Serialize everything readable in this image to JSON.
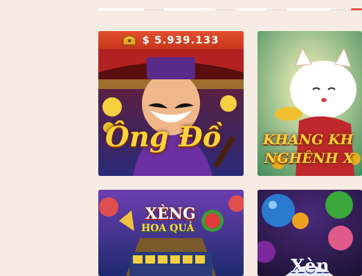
{
  "tabs": [
    {
      "label": "",
      "active": false
    },
    {
      "label": "",
      "active": false
    },
    {
      "label": "",
      "active": false
    },
    {
      "label": "",
      "active": false
    },
    {
      "label": "",
      "active": true
    }
  ],
  "games": [
    {
      "title": "Ông Đồ",
      "jackpot": "$ 5.939.133"
    },
    {
      "title": "KHANG KH",
      "title_line2": "NGHÊNH X"
    },
    {
      "title": "XÈNG",
      "title_line2": "HOA QUẢ"
    },
    {
      "title": "Xèn"
    }
  ],
  "colors": {
    "background": "#f6ece4",
    "jackpot_bar": "#d8432a",
    "accent": "#e05040"
  }
}
